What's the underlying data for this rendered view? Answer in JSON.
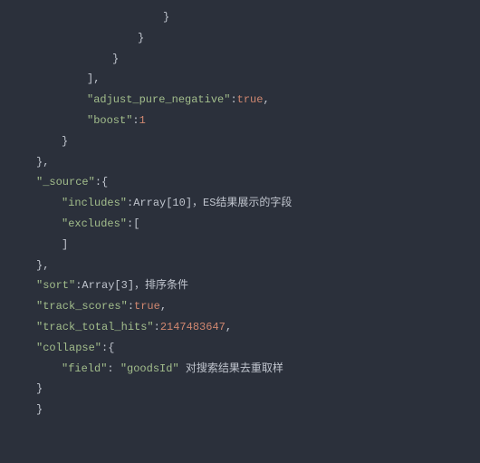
{
  "lines": {
    "l1": "}",
    "l2": "}",
    "l3": "}",
    "l4": "],",
    "l5_key": "\"adjust_pure_negative\"",
    "l5_sep": ":",
    "l5_val": "true",
    "l5_end": ",",
    "l6_key": "\"boost\"",
    "l6_sep": ":",
    "l6_val": "1",
    "l7": "}",
    "l8": "},",
    "l9_key": "\"_source\"",
    "l9_rest": ":{",
    "l10_key": "\"includes\"",
    "l10_sep": ":",
    "l10_arr": "Array[10]",
    "l10_comment": "，ES结果展示的字段",
    "l11_key": "\"excludes\"",
    "l11_rest": ":[",
    "l12": "",
    "l13": "]",
    "l14": "},",
    "l15_key": "\"sort\"",
    "l15_sep": ":",
    "l15_arr": "Array[3]",
    "l15_comment": "，排序条件",
    "l16_key": "\"track_scores\"",
    "l16_sep": ":",
    "l16_val": "true",
    "l16_end": ",",
    "l17_key": "\"track_total_hits\"",
    "l17_sep": ":",
    "l17_val": "2147483647",
    "l17_end": ",",
    "l18_key": "\"collapse\"",
    "l18_rest": ":{",
    "l19_key": "\"field\"",
    "l19_sep": ": ",
    "l19_val": "\"goodsId\"",
    "l19_comment": " 对搜索结果去重取样",
    "l20": "}",
    "l21": "}"
  }
}
